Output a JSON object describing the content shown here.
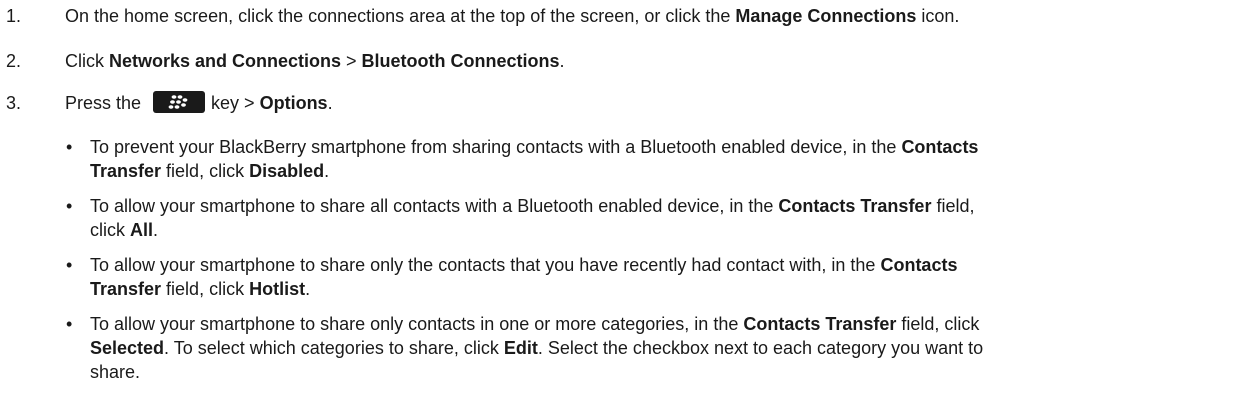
{
  "steps": [
    {
      "num": "1.",
      "parts": [
        {
          "t": "On the home screen, click the connections area at the top of the screen, or click the ",
          "b": false
        },
        {
          "t": "Manage Connections",
          "b": true
        },
        {
          "t": " icon.",
          "b": false
        }
      ]
    },
    {
      "num": "2.",
      "parts": [
        {
          "t": "Click ",
          "b": false
        },
        {
          "t": "Networks and Connections",
          "b": true
        },
        {
          "t": " > ",
          "b": false
        },
        {
          "t": "Bluetooth Connections",
          "b": true
        },
        {
          "t": ".",
          "b": false
        }
      ]
    },
    {
      "num": "3.",
      "pre": "Press the",
      "key_icon": "blackberry-menu-key-icon",
      "post_plain": "key > ",
      "post_bold": "Options",
      "post_end": "."
    }
  ],
  "bullets": [
    {
      "lines": [
        [
          {
            "t": "To prevent your BlackBerry smartphone from sharing contacts with a Bluetooth enabled device, in the ",
            "b": false
          },
          {
            "t": "Contacts",
            "b": true
          }
        ],
        [
          {
            "t": "Transfer",
            "b": true
          },
          {
            "t": " field, click ",
            "b": false
          },
          {
            "t": "Disabled",
            "b": true
          },
          {
            "t": ".",
            "b": false
          }
        ]
      ]
    },
    {
      "lines": [
        [
          {
            "t": "To allow your smartphone to share all contacts with a Bluetooth enabled device, in the ",
            "b": false
          },
          {
            "t": "Contacts Transfer",
            "b": true
          },
          {
            "t": " field,",
            "b": false
          }
        ],
        [
          {
            "t": "click ",
            "b": false
          },
          {
            "t": "All",
            "b": true
          },
          {
            "t": ".",
            "b": false
          }
        ]
      ]
    },
    {
      "lines": [
        [
          {
            "t": "To allow your smartphone to share only the contacts that you have recently had contact with, in the ",
            "b": false
          },
          {
            "t": "Contacts",
            "b": true
          }
        ],
        [
          {
            "t": "Transfer",
            "b": true
          },
          {
            "t": " field, click ",
            "b": false
          },
          {
            "t": "Hotlist",
            "b": true
          },
          {
            "t": ".",
            "b": false
          }
        ]
      ]
    },
    {
      "lines": [
        [
          {
            "t": "To allow your smartphone to share only contacts in one or more categories, in the ",
            "b": false
          },
          {
            "t": "Contacts Transfer",
            "b": true
          },
          {
            "t": " field, click",
            "b": false
          }
        ],
        [
          {
            "t": "Selected",
            "b": true
          },
          {
            "t": ". To select which categories to share, click ",
            "b": false
          },
          {
            "t": "Edit",
            "b": true
          },
          {
            "t": ". Select the checkbox next to each category you want to",
            "b": false
          }
        ],
        [
          {
            "t": "share.",
            "b": false
          }
        ]
      ]
    }
  ],
  "bullet_glyph": "•"
}
